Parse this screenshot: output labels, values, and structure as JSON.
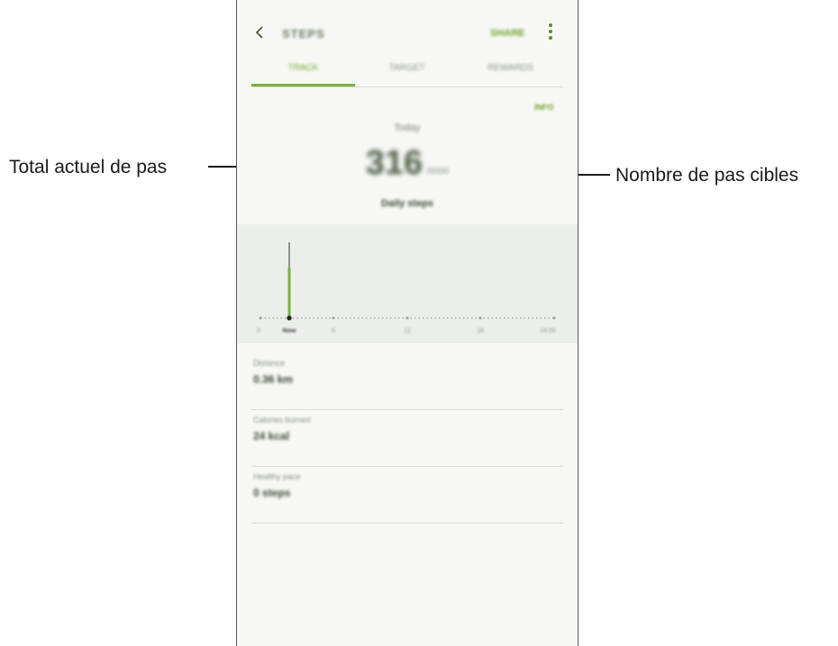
{
  "callouts": {
    "left": "Total actuel de pas",
    "right": "Nombre de pas cibles"
  },
  "app": {
    "title": "STEPS",
    "share_label": "SHARE",
    "tabs": [
      {
        "label": "TRACK",
        "active": true
      },
      {
        "label": "TARGET",
        "active": false
      },
      {
        "label": "REWARDS",
        "active": false
      }
    ]
  },
  "summary": {
    "goal_link": "INFO",
    "date_label": "Today",
    "steps_now": "316",
    "steps_target": "/6000",
    "caption": "Daily steps"
  },
  "chart_data": {
    "type": "bar",
    "x_tick_labels": [
      "0",
      "Now",
      "6",
      "12",
      "18",
      "24:00"
    ],
    "highlighted_label": "Now",
    "accent_color": "#7bb03a"
  },
  "stats": [
    {
      "label": "Distance",
      "value": "0.36 km"
    },
    {
      "label": "Calories burned",
      "value": "24 kcal"
    },
    {
      "label": "Healthy pace",
      "value": "0 steps"
    }
  ]
}
